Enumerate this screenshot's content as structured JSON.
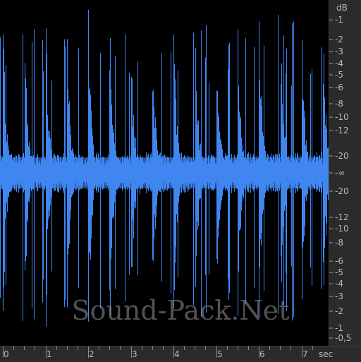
{
  "watermark": "Sound-Pack.Net",
  "colors": {
    "background": "#000000",
    "waveform": "#3f86f0",
    "ruler_bg": "#2b2b2b",
    "ruler_text": "#b8b8b8"
  },
  "db_scale": {
    "unit": "dB",
    "upper_labels": [
      "-1",
      "-2",
      "-3",
      "-4",
      "-5",
      "-6",
      "-8",
      "-10",
      "-12",
      "-20"
    ],
    "center_label": "-∞",
    "lower_labels": [
      "-20",
      "-12",
      "-10",
      "-8",
      "-6",
      "-5",
      "-4",
      "-3",
      "-2",
      "-1",
      "-0,5"
    ]
  },
  "time_scale": {
    "unit": "sec",
    "labels": [
      "0",
      "1",
      "2",
      "3",
      "4",
      "5",
      "6",
      "7"
    ]
  },
  "waveform": {
    "duration_sec": 7.5,
    "beats_per_second": 2
  }
}
